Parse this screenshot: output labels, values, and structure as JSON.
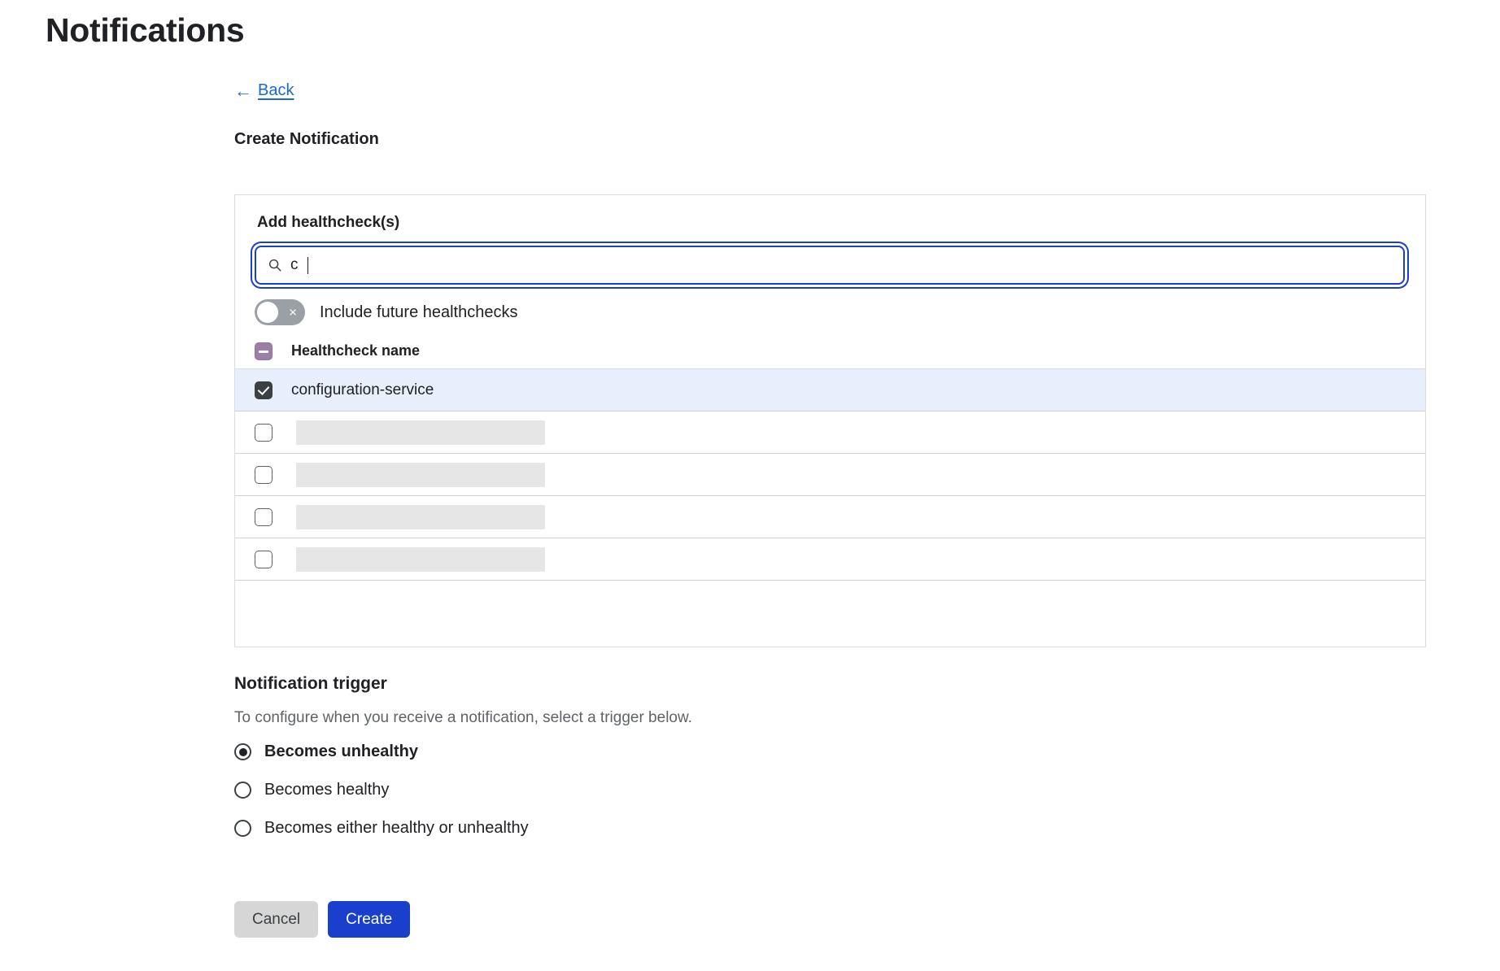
{
  "page": {
    "title": "Notifications"
  },
  "back": {
    "label": "Back",
    "arrow": "←"
  },
  "form": {
    "heading": "Create Notification",
    "healthcheck_panel": {
      "label": "Add healthcheck(s)",
      "search": {
        "value": "c",
        "placeholder": "",
        "icon": "search-icon"
      },
      "toggle": {
        "label": "Include future healthchecks",
        "state": "off",
        "glyph": "×"
      },
      "table": {
        "header_checkbox_state": "indeterminate",
        "columns": [
          "Healthcheck name"
        ],
        "rows": [
          {
            "name": "configuration-service",
            "checked": true,
            "selected": true,
            "loading": false
          },
          {
            "name": "",
            "checked": false,
            "selected": false,
            "loading": true
          },
          {
            "name": "",
            "checked": false,
            "selected": false,
            "loading": true
          },
          {
            "name": "",
            "checked": false,
            "selected": false,
            "loading": true
          },
          {
            "name": "",
            "checked": false,
            "selected": false,
            "loading": true
          }
        ]
      }
    },
    "trigger": {
      "title": "Notification trigger",
      "description": "To configure when you receive a notification, select a trigger below.",
      "options": [
        {
          "label": "Becomes unhealthy",
          "selected": true
        },
        {
          "label": "Becomes healthy",
          "selected": false
        },
        {
          "label": "Becomes either healthy or unhealthy",
          "selected": false
        }
      ]
    },
    "actions": {
      "cancel_label": "Cancel",
      "create_label": "Create"
    }
  },
  "colors": {
    "accent_blue": "#1a3fcc",
    "link_blue": "#1a67d8",
    "selected_row": "#e8eefb",
    "indeterminate": "#9b7fa6",
    "checkbox_checked": "#3c4043",
    "skeleton": "#e6e6e6"
  }
}
